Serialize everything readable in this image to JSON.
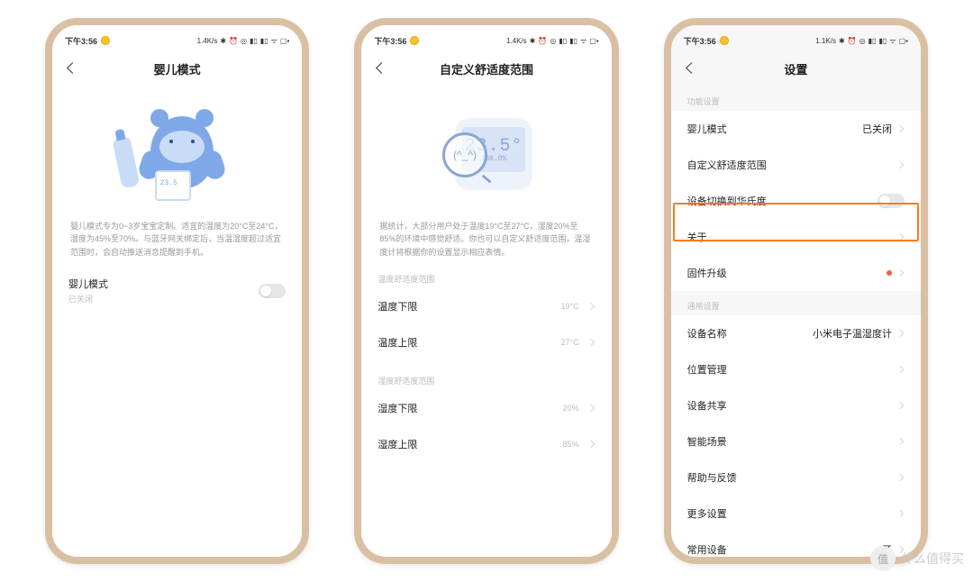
{
  "status": {
    "time": "下午3:56",
    "speed1": "1.4K/s",
    "speed3": "1.1K/s",
    "icons": "✻ ⏰ ◎ 📶 📶 📶 🔋"
  },
  "screen1": {
    "title": "婴儿模式",
    "desc": "婴儿模式专为0~3岁宝宝定制。适宜的温度为20°C至24°C，湿度为45%至70%。与蓝牙网关绑定后，当温湿度超过适宜范围时，会自动推送消息提醒到手机。",
    "row_label": "婴儿模式",
    "row_sub": "已关闭"
  },
  "screen2": {
    "title": "自定义舒适度范围",
    "desc": "据统计，大部分用户处于温度19°C至27°C，湿度20%至85%的环境中感觉舒适。你也可以自定义舒适度范围，温湿度计将根据你的设置显示相应表情。",
    "sec1": "温度舒适度范围",
    "temp_low_label": "温度下限",
    "temp_low_val": "19°C",
    "temp_high_label": "温度上限",
    "temp_high_val": "27°C",
    "sec2": "湿度舒适度范围",
    "hum_low_label": "湿度下限",
    "hum_low_val": "20%",
    "hum_high_label": "湿度上限",
    "hum_high_val": "85%"
  },
  "screen3": {
    "title": "设置",
    "sec_func": "功能设置",
    "baby": "婴儿模式",
    "baby_val": "已关闭",
    "custom": "自定义舒适度范围",
    "fahrenheit": "设备切换到华氏度",
    "about": "关于",
    "firmware": "固件升级",
    "sec_general": "通用设置",
    "devname": "设备名称",
    "devname_val": "小米电子温湿度计",
    "location": "位置管理",
    "share": "设备共享",
    "scene": "智能场景",
    "help": "帮助与反馈",
    "more": "更多设置",
    "common": "常用设备",
    "common_val": "开"
  },
  "watermark": "什么值得买"
}
